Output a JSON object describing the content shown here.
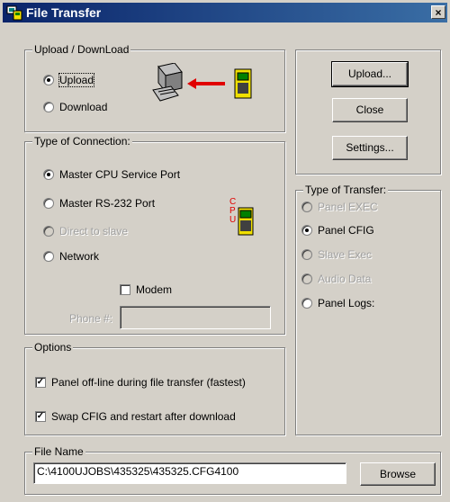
{
  "window": {
    "title": "File Transfer",
    "close_glyph": "×"
  },
  "upload_download": {
    "legend": "Upload / DownLoad",
    "options": [
      {
        "label": "Upload",
        "checked": true
      },
      {
        "label": "Download",
        "checked": false
      }
    ]
  },
  "connection": {
    "legend": "Type of Connection:",
    "options": [
      {
        "label": "Master CPU Service Port",
        "checked": true,
        "enabled": true
      },
      {
        "label": "Master RS-232 Port",
        "checked": false,
        "enabled": true
      },
      {
        "label": "Direct to slave",
        "checked": false,
        "enabled": false
      },
      {
        "label": "Network",
        "checked": false,
        "enabled": true
      }
    ],
    "modem_label": "Modem",
    "modem_checked": false,
    "phone_label": "Phone #:",
    "phone_value": "",
    "cpu_label": "CPU"
  },
  "options_group": {
    "legend": "Options",
    "items": [
      {
        "label": "Panel off-line during file transfer (fastest)",
        "checked": true
      },
      {
        "label": "Swap CFIG and restart after download",
        "checked": true
      }
    ]
  },
  "buttons": {
    "upload": "Upload...",
    "close": "Close",
    "settings": "Settings..."
  },
  "transfer": {
    "legend": "Type of Transfer:",
    "options": [
      {
        "label": "Panel EXEC",
        "checked": false,
        "enabled": false
      },
      {
        "label": "Panel CFIG",
        "checked": true,
        "enabled": true
      },
      {
        "label": "Slave Exec",
        "checked": false,
        "enabled": false
      },
      {
        "label": "Audio Data",
        "checked": false,
        "enabled": false
      },
      {
        "label": "Panel Logs:",
        "checked": false,
        "enabled": true
      }
    ]
  },
  "file_name": {
    "legend": "File Name",
    "value": "C:\\4100UJOBS\\435325\\435325.CFG4100",
    "browse": "Browse"
  },
  "icons": [
    "app-icon",
    "computer-icon",
    "arrow-left-icon",
    "panel-icon",
    "cpu-panel-icon"
  ],
  "colors": {
    "titlebar": "#0a246a",
    "window": "#d4d0c8",
    "arrow": "#e00000",
    "panel": "#f0e000"
  }
}
